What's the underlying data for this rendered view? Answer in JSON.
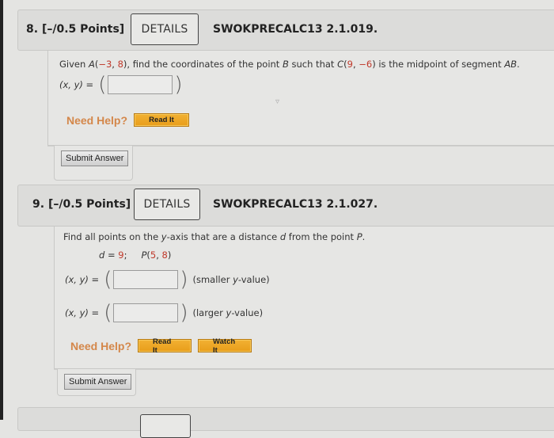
{
  "questions": [
    {
      "number": "8.",
      "points": "[–/0.5 Points]",
      "details_label": "DETAILS",
      "code": "SWOKPRECALC13 2.1.019.",
      "prompt": {
        "part1": "Given ",
        "A_label": "A",
        "A_coords_open": "(",
        "A_x": "−3",
        "A_sep": ", ",
        "A_y": "8",
        "A_coords_close": ")",
        "part2": ", find the coordinates of the point ",
        "B_label": "B",
        "part3": " such that ",
        "C_label": "C",
        "C_open": "(",
        "C_x": "9",
        "C_sep": ", ",
        "C_y": "−6",
        "C_close": ")",
        "part4": " is the midpoint of segment ",
        "AB_label": "AB",
        "part5": "."
      },
      "answers": [
        {
          "label": "(x, y) =",
          "value": "",
          "hint": ""
        }
      ],
      "need_help_label": "Need Help?",
      "help_buttons": [
        "Read It"
      ],
      "submit_label": "Submit Answer"
    },
    {
      "number": "9.",
      "points": "[–/0.5 Points]",
      "details_label": "DETAILS",
      "code": "SWOKPRECALC13 2.1.027.",
      "prompt": {
        "part1": "Find all points on the ",
        "y_label": "y",
        "part2": "-axis that are a distance ",
        "d_label": "d",
        "part3": " from the point ",
        "P_label": "P",
        "part4": ".",
        "given_d_label": "d",
        "given_d_eq": " = ",
        "given_d_value": "9",
        "given_sep": ";",
        "given_P_label": "P",
        "given_P_open": "(",
        "given_P_x": "5",
        "given_P_sep": ", ",
        "given_P_y": "8",
        "given_P_close": ")"
      },
      "answers": [
        {
          "label": "(x, y) =",
          "value": "",
          "hint_open": "(smaller ",
          "hint_var": "y",
          "hint_close": "-value)"
        },
        {
          "label": "(x, y) =",
          "value": "",
          "hint_open": "(larger ",
          "hint_var": "y",
          "hint_close": "-value)"
        }
      ],
      "need_help_label": "Need Help?",
      "help_buttons": [
        "Read It",
        "Watch It"
      ],
      "submit_label": "Submit Answer"
    }
  ],
  "paren_open": "(",
  "paren_close": ")"
}
